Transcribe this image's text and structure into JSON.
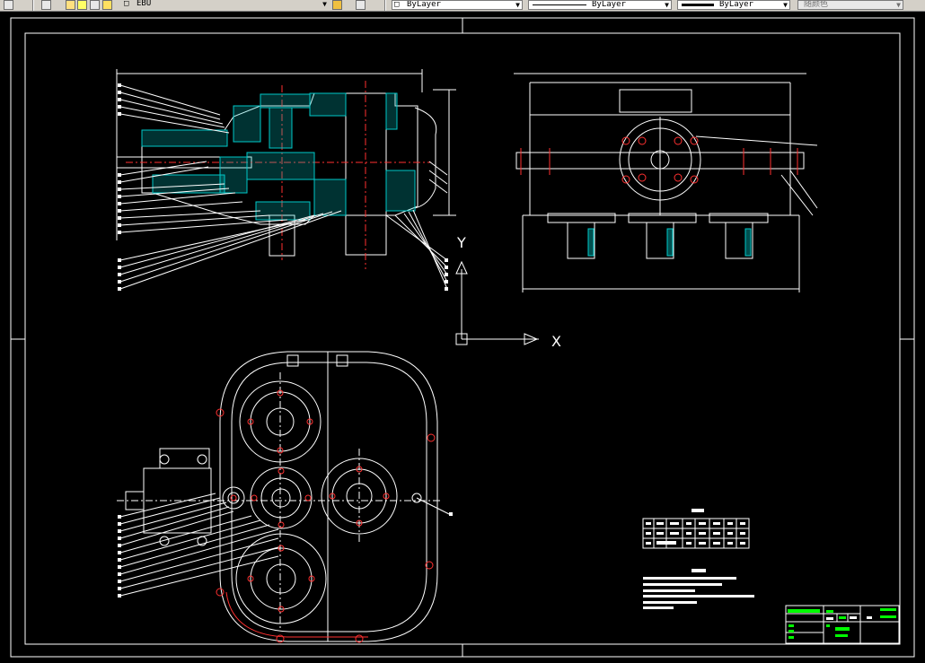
{
  "toolbar": {
    "layer_name": "EBU",
    "color_combo": "ByLayer",
    "linetype_combo": "ByLayer",
    "lineweight_combo": "ByLayer",
    "plotstyle_combo": "随颜色"
  },
  "drawing": {
    "ucs_y_label": "Y",
    "ucs_x_label": "X"
  },
  "colors": {
    "background": "#000000",
    "line": "#ffffff",
    "hatch": "#00c8c8",
    "centerline": "#ff3030",
    "title_green": "#00ff00"
  }
}
